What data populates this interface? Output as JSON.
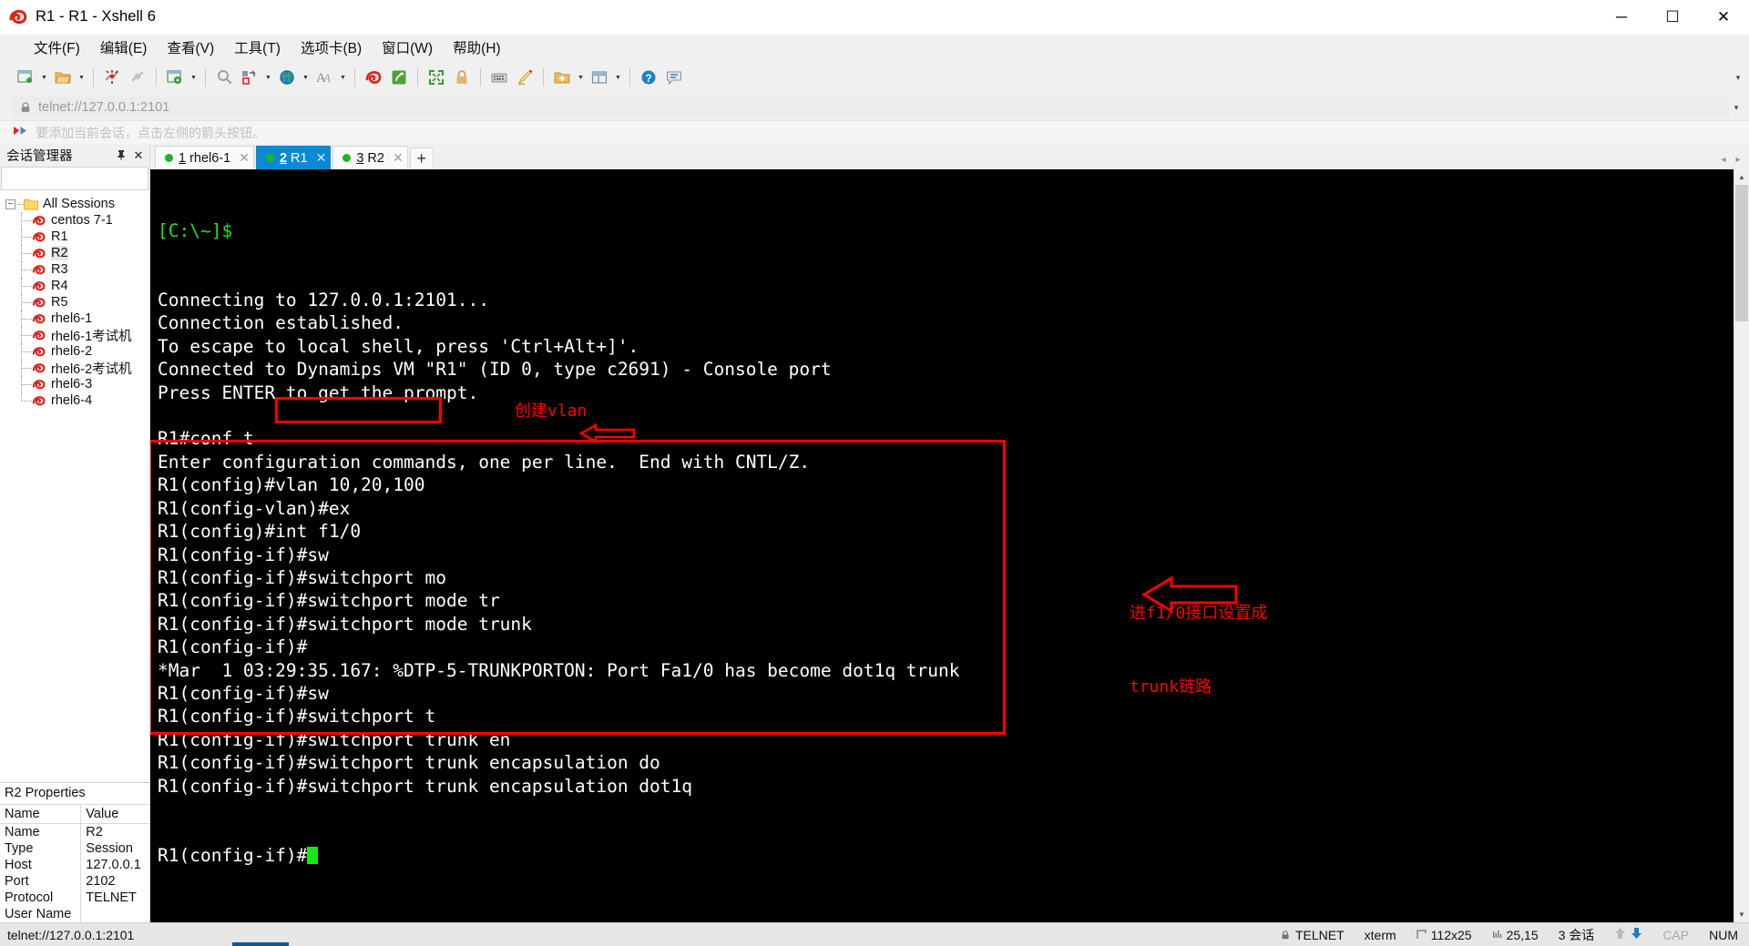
{
  "window": {
    "title": "R1 - R1 - Xshell 6",
    "app_icon": "xshell-logo-icon",
    "minimize": "─",
    "maximize": "☐",
    "close": "✕"
  },
  "menubar": {
    "items": [
      {
        "label": "文件(F)",
        "name": "menu-file"
      },
      {
        "label": "编辑(E)",
        "name": "menu-edit"
      },
      {
        "label": "查看(V)",
        "name": "menu-view"
      },
      {
        "label": "工具(T)",
        "name": "menu-tools"
      },
      {
        "label": "选项卡(B)",
        "name": "menu-tabs"
      },
      {
        "label": "窗口(W)",
        "name": "menu-window"
      },
      {
        "label": "帮助(H)",
        "name": "menu-help"
      }
    ]
  },
  "toolbar": {
    "collapse_glyph": "▾",
    "items": [
      {
        "name": "new-session-icon",
        "dropdown": true
      },
      {
        "name": "open-folder-icon",
        "dropdown": true
      },
      {
        "sep": true
      },
      {
        "name": "disconnect-icon",
        "dropdown": false
      },
      {
        "name": "reconnect-icon",
        "dropdown": false
      },
      {
        "sep": true
      },
      {
        "name": "session-properties-icon",
        "dropdown": true
      },
      {
        "sep": true
      },
      {
        "name": "find-icon",
        "dropdown": false
      },
      {
        "name": "file-transfer-icon",
        "dropdown": true
      },
      {
        "name": "web-browser-icon",
        "dropdown": true
      },
      {
        "name": "font-icon",
        "dropdown": true
      },
      {
        "sep": true
      },
      {
        "name": "xshell-icon",
        "dropdown": false
      },
      {
        "name": "xftp-icon",
        "dropdown": false
      },
      {
        "sep": true
      },
      {
        "name": "fullscreen-icon",
        "dropdown": false
      },
      {
        "name": "lock-icon",
        "dropdown": false
      },
      {
        "sep": true
      },
      {
        "name": "keyboard-icon",
        "dropdown": false
      },
      {
        "name": "highlight-pen-icon",
        "dropdown": false
      },
      {
        "sep": true
      },
      {
        "name": "add-folder-icon",
        "dropdown": true
      },
      {
        "name": "layout-icon",
        "dropdown": true
      },
      {
        "sep": true
      },
      {
        "name": "help-icon",
        "dropdown": false
      },
      {
        "name": "feedback-icon",
        "dropdown": false
      }
    ]
  },
  "address_bar": {
    "lock_icon": "lock-icon",
    "value": "telnet://127.0.0.1:2101",
    "placeholder": "telnet://127.0.0.1:2101",
    "dropdown_glyph": "▾"
  },
  "hint_bar": {
    "icon": "red-arrow-icon",
    "text": "要添加当前会话，点击左侧的箭头按钮。"
  },
  "session_manager": {
    "title": "会话管理器",
    "pin_glyph": "⚓",
    "close_glyph": "✕",
    "search_value": "",
    "search_placeholder": "",
    "search_icon": "search-icon",
    "root": {
      "label": "All Sessions",
      "expander": "−",
      "icon": "folder-icon"
    },
    "sessions": [
      {
        "label": "centos 7-1",
        "selected": false
      },
      {
        "label": "R1",
        "selected": false
      },
      {
        "label": "R2",
        "selected": true
      },
      {
        "label": "R3",
        "selected": false
      },
      {
        "label": "R4",
        "selected": false
      },
      {
        "label": "R5",
        "selected": false
      },
      {
        "label": "rhel6-1",
        "selected": false
      },
      {
        "label": "rhel6-1考试机",
        "selected": false
      },
      {
        "label": "rhel6-2",
        "selected": false
      },
      {
        "label": "rhel6-2考试机",
        "selected": false
      },
      {
        "label": "rhel6-3",
        "selected": false
      },
      {
        "label": "rhel6-4",
        "selected": false
      }
    ]
  },
  "properties": {
    "title": "R2 Properties",
    "columns": [
      "Name",
      "Value"
    ],
    "rows": [
      {
        "name": "Name",
        "value": "R2"
      },
      {
        "name": "Type",
        "value": "Session"
      },
      {
        "name": "Host",
        "value": "127.0.0.1"
      },
      {
        "name": "Port",
        "value": "2102"
      },
      {
        "name": "Protocol",
        "value": "TELNET"
      },
      {
        "name": "User Name",
        "value": ""
      }
    ]
  },
  "tabs": {
    "items": [
      {
        "num": "1",
        "label": "rhel6-1",
        "active": false,
        "close": "✕"
      },
      {
        "num": "2",
        "label": "R1",
        "active": true,
        "close": "✕"
      },
      {
        "num": "3",
        "label": "R2",
        "active": false,
        "close": "✕"
      }
    ],
    "add_glyph": "+",
    "nav_left": "◂",
    "nav_right": "▸"
  },
  "terminal": {
    "prompt_line": "[C:\\~]$",
    "lines": [
      "",
      "",
      "Connecting to 127.0.0.1:2101...",
      "Connection established.",
      "To escape to local shell, press 'Ctrl+Alt+]'.",
      "Connected to Dynamips VM \"R1\" (ID 0, type c2691) - Console port",
      "Press ENTER to get the prompt.",
      "",
      "R1#conf t",
      "Enter configuration commands, one per line.  End with CNTL/Z.",
      "R1(config)#vlan 10,20,100",
      "R1(config-vlan)#ex",
      "R1(config)#int f1/0",
      "R1(config-if)#sw",
      "R1(config-if)#switchport mo",
      "R1(config-if)#switchport mode tr",
      "R1(config-if)#switchport mode trunk",
      "R1(config-if)#",
      "*Mar  1 03:29:35.167: %DTP-5-TRUNKPORTON: Port Fa1/0 has become dot1q trunk",
      "R1(config-if)#sw",
      "R1(config-if)#switchport t",
      "R1(config-if)#switchport trunk en",
      "R1(config-if)#switchport trunk encapsulation do",
      "R1(config-if)#switchport trunk encapsulation dot1q"
    ],
    "last_line": "R1(config-if)#"
  },
  "annotations": {
    "color": "#ff0000",
    "vlan_note": "创建vlan",
    "trunk_note_line1": "进f1/0接口设置成",
    "trunk_note_line2": "trunk链路",
    "arrow_glyph": "⇐"
  },
  "status_bar": {
    "left": "telnet://127.0.0.1:2101",
    "protocol_icon": "lock-icon",
    "protocol": "TELNET",
    "terminal_type": "xterm",
    "size_icon": "resize-icon",
    "size": "112x25",
    "cursor_icon": "cursor-icon",
    "cursor": "25,15",
    "sessions": "3 会话",
    "up_glyph": "⬆",
    "down_glyph": "⬇",
    "cap": "CAP",
    "num": "NUM"
  },
  "colors": {
    "accent": "#0a8ad2",
    "terminal_bg": "#000000",
    "terminal_fg": "#ffffff",
    "prompt_green": "#17e817",
    "annotation_red": "#ff0000"
  }
}
